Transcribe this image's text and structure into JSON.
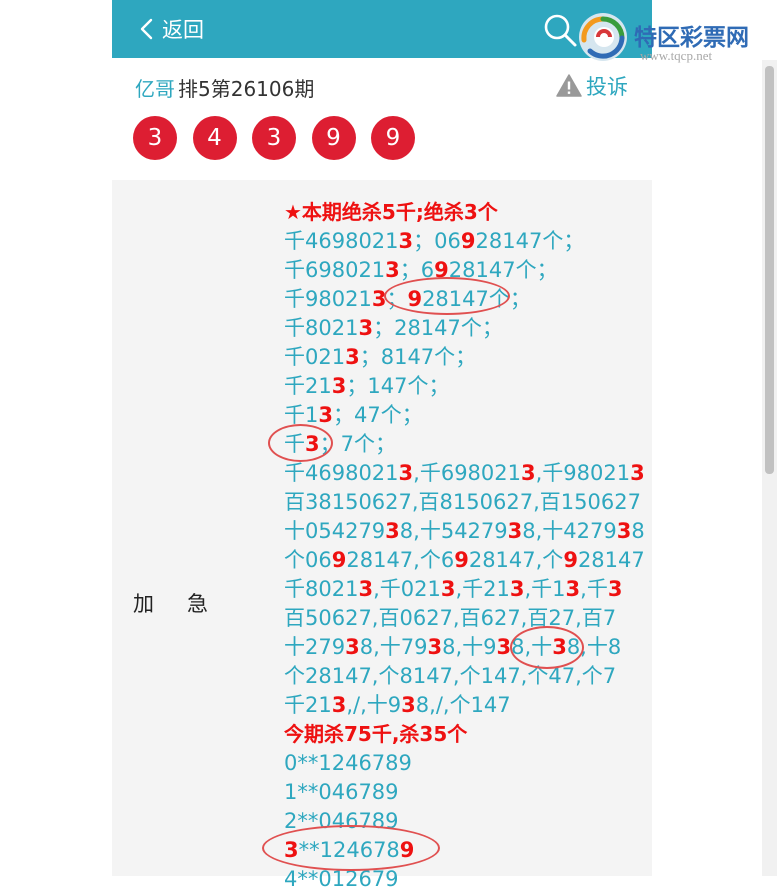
{
  "header": {
    "back_label": "返回",
    "logo_title": "特区彩票网",
    "logo_url": "www.tqcp.net"
  },
  "info": {
    "author": "亿哥",
    "issue": "排5第26106期",
    "report_label": "投诉"
  },
  "balls": [
    "3",
    "4",
    "3",
    "9",
    "9"
  ],
  "category_label": "加急",
  "content_lines": [
    {
      "style": "headline",
      "segs": [
        {
          "t": "★本期绝杀5千;绝杀3个"
        }
      ]
    },
    {
      "segs": [
        {
          "t": "千4698021"
        },
        {
          "t": "3",
          "r": true
        },
        {
          "t": "；06"
        },
        {
          "t": "9",
          "r": true
        },
        {
          "t": "28147个；"
        }
      ]
    },
    {
      "segs": [
        {
          "t": "千698021"
        },
        {
          "t": "3",
          "r": true
        },
        {
          "t": "；6"
        },
        {
          "t": "9",
          "r": true
        },
        {
          "t": "28147个；"
        }
      ]
    },
    {
      "segs": [
        {
          "t": "千98021"
        },
        {
          "t": "3",
          "r": true
        },
        {
          "t": "；"
        },
        {
          "t": "9",
          "r": true
        },
        {
          "t": "28147个；"
        }
      ]
    },
    {
      "segs": [
        {
          "t": "千8021"
        },
        {
          "t": "3",
          "r": true
        },
        {
          "t": "；28147个；"
        }
      ]
    },
    {
      "segs": [
        {
          "t": "千021"
        },
        {
          "t": "3",
          "r": true
        },
        {
          "t": "；8147个；"
        }
      ]
    },
    {
      "segs": [
        {
          "t": "千21"
        },
        {
          "t": "3",
          "r": true
        },
        {
          "t": "；147个；"
        }
      ]
    },
    {
      "segs": [
        {
          "t": "千1"
        },
        {
          "t": "3",
          "r": true
        },
        {
          "t": "；47个；"
        }
      ]
    },
    {
      "segs": [
        {
          "t": "千"
        },
        {
          "t": "3",
          "r": true
        },
        {
          "t": "；7个；"
        }
      ]
    },
    {
      "segs": [
        {
          "t": "千4698021"
        },
        {
          "t": "3",
          "r": true
        },
        {
          "t": ",千698021"
        },
        {
          "t": "3",
          "r": true
        },
        {
          "t": ",千98021"
        },
        {
          "t": "3",
          "r": true
        }
      ]
    },
    {
      "segs": [
        {
          "t": "百38150627,百8150627,百150627"
        }
      ]
    },
    {
      "segs": [
        {
          "t": "十054279"
        },
        {
          "t": "3",
          "r": true
        },
        {
          "t": "8,十54279"
        },
        {
          "t": "3",
          "r": true
        },
        {
          "t": "8,十4279"
        },
        {
          "t": "3",
          "r": true
        },
        {
          "t": "8"
        }
      ]
    },
    {
      "segs": [
        {
          "t": "个06"
        },
        {
          "t": "9",
          "r": true
        },
        {
          "t": "28147,个6"
        },
        {
          "t": "9",
          "r": true
        },
        {
          "t": "28147,个"
        },
        {
          "t": "9",
          "r": true
        },
        {
          "t": "28147"
        }
      ]
    },
    {
      "segs": [
        {
          "t": "千8021"
        },
        {
          "t": "3",
          "r": true
        },
        {
          "t": ",千021"
        },
        {
          "t": "3",
          "r": true
        },
        {
          "t": ",千21"
        },
        {
          "t": "3",
          "r": true
        },
        {
          "t": ",千1"
        },
        {
          "t": "3",
          "r": true
        },
        {
          "t": ",千"
        },
        {
          "t": "3",
          "r": true
        }
      ]
    },
    {
      "segs": [
        {
          "t": "百50627,百0627,百627,百27,百7"
        }
      ]
    },
    {
      "segs": [
        {
          "t": "十279"
        },
        {
          "t": "3",
          "r": true
        },
        {
          "t": "8,十79"
        },
        {
          "t": "3",
          "r": true
        },
        {
          "t": "8,十9"
        },
        {
          "t": "3",
          "r": true
        },
        {
          "t": "8,十"
        },
        {
          "t": "3",
          "r": true
        },
        {
          "t": "8,十8"
        }
      ]
    },
    {
      "segs": [
        {
          "t": "个28147,个8147,个147,个47,个7"
        }
      ]
    },
    {
      "segs": [
        {
          "t": "千21"
        },
        {
          "t": "3",
          "r": true
        },
        {
          "t": ",/,十9"
        },
        {
          "t": "3",
          "r": true
        },
        {
          "t": "8,/,个147"
        }
      ]
    },
    {
      "style": "headline",
      "segs": [
        {
          "t": "今期杀75千,杀35个"
        }
      ]
    },
    {
      "segs": [
        {
          "t": "0**1246789"
        }
      ]
    },
    {
      "segs": [
        {
          "t": "1**046789"
        }
      ]
    },
    {
      "segs": [
        {
          "t": "2**046789"
        }
      ]
    },
    {
      "segs": [
        {
          "t": "3",
          "r": true
        },
        {
          "t": "**124678"
        },
        {
          "t": "9",
          "r": true
        }
      ]
    },
    {
      "segs": [
        {
          "t": "4**012679"
        }
      ]
    }
  ],
  "colors": {
    "header_bg": "#2ea7bf",
    "accent_text": "#2ea7bf",
    "ball_red": "#dd1e32",
    "highlight_red": "#ee1111",
    "annotation_circle": "#e05050",
    "content_bg": "#f4f4f4"
  },
  "icons": [
    "chevron-left-icon",
    "search-icon",
    "warning-icon",
    "site-logo-icon"
  ]
}
